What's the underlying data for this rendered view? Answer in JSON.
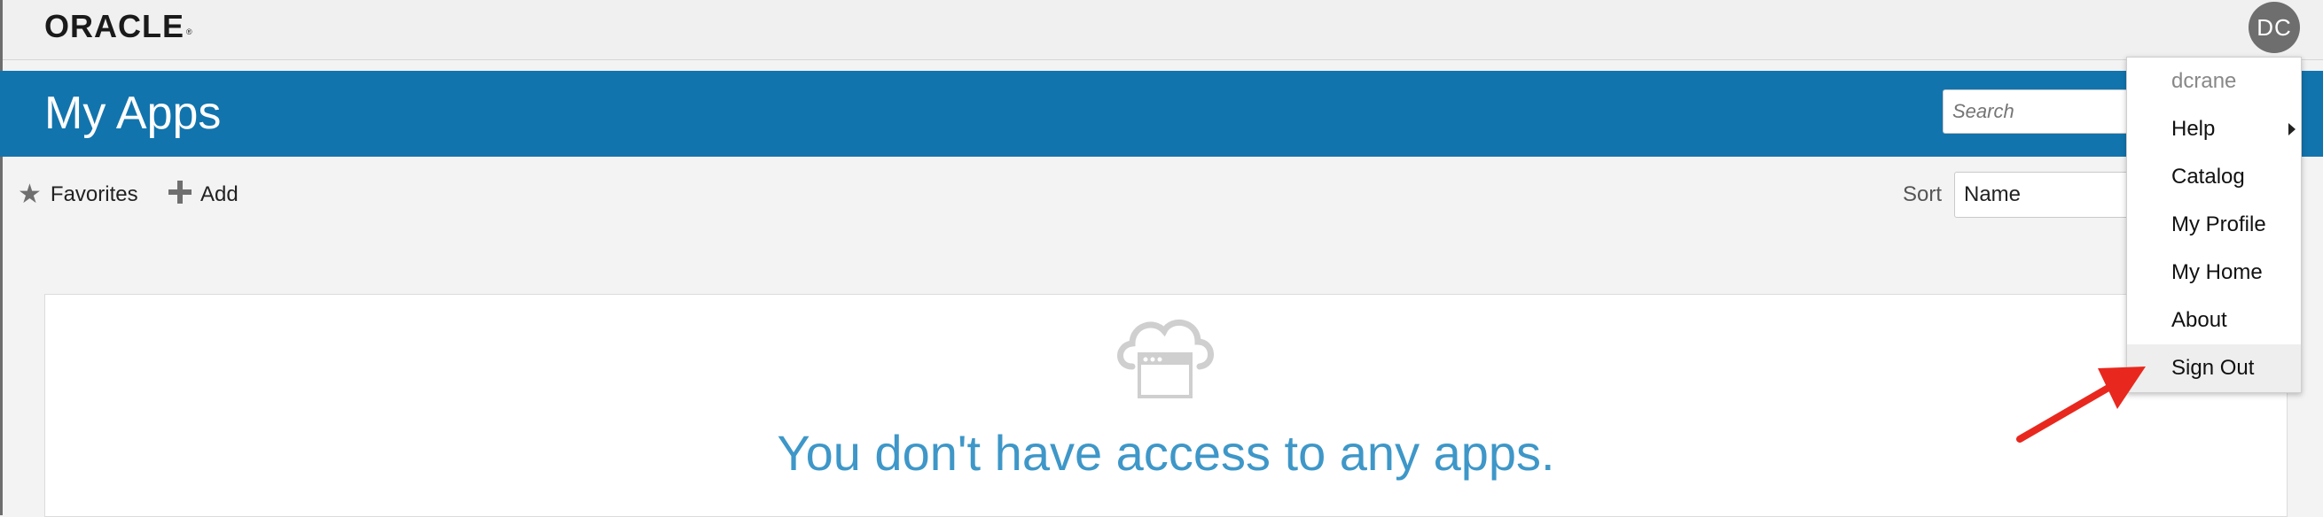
{
  "brand": {
    "logo": "ORACLE",
    "trademark": "®"
  },
  "user": {
    "initials": "DC",
    "username": "dcrane"
  },
  "header": {
    "title": "My Apps",
    "search_placeholder": "Search"
  },
  "toolbar": {
    "favorites_label": "Favorites",
    "favorites_icon": "star-icon",
    "add_label": "Add",
    "add_icon": "plus-icon",
    "sort_label": "Sort",
    "sort_value": "Name"
  },
  "empty_state": {
    "icon": "cloud-app-icon",
    "message": "You don't have access to any apps."
  },
  "user_menu": {
    "items": [
      {
        "label": "dcrane"
      },
      {
        "label": "Help"
      },
      {
        "label": "Catalog"
      },
      {
        "label": "My Profile"
      },
      {
        "label": "My Home"
      },
      {
        "label": "About"
      },
      {
        "label": "Sign Out"
      }
    ]
  },
  "colors": {
    "header_blue": "#1274ad",
    "message_blue": "#3e97c8",
    "annotation_red": "#e8281e",
    "avatar_gray": "#6e6e6e"
  }
}
